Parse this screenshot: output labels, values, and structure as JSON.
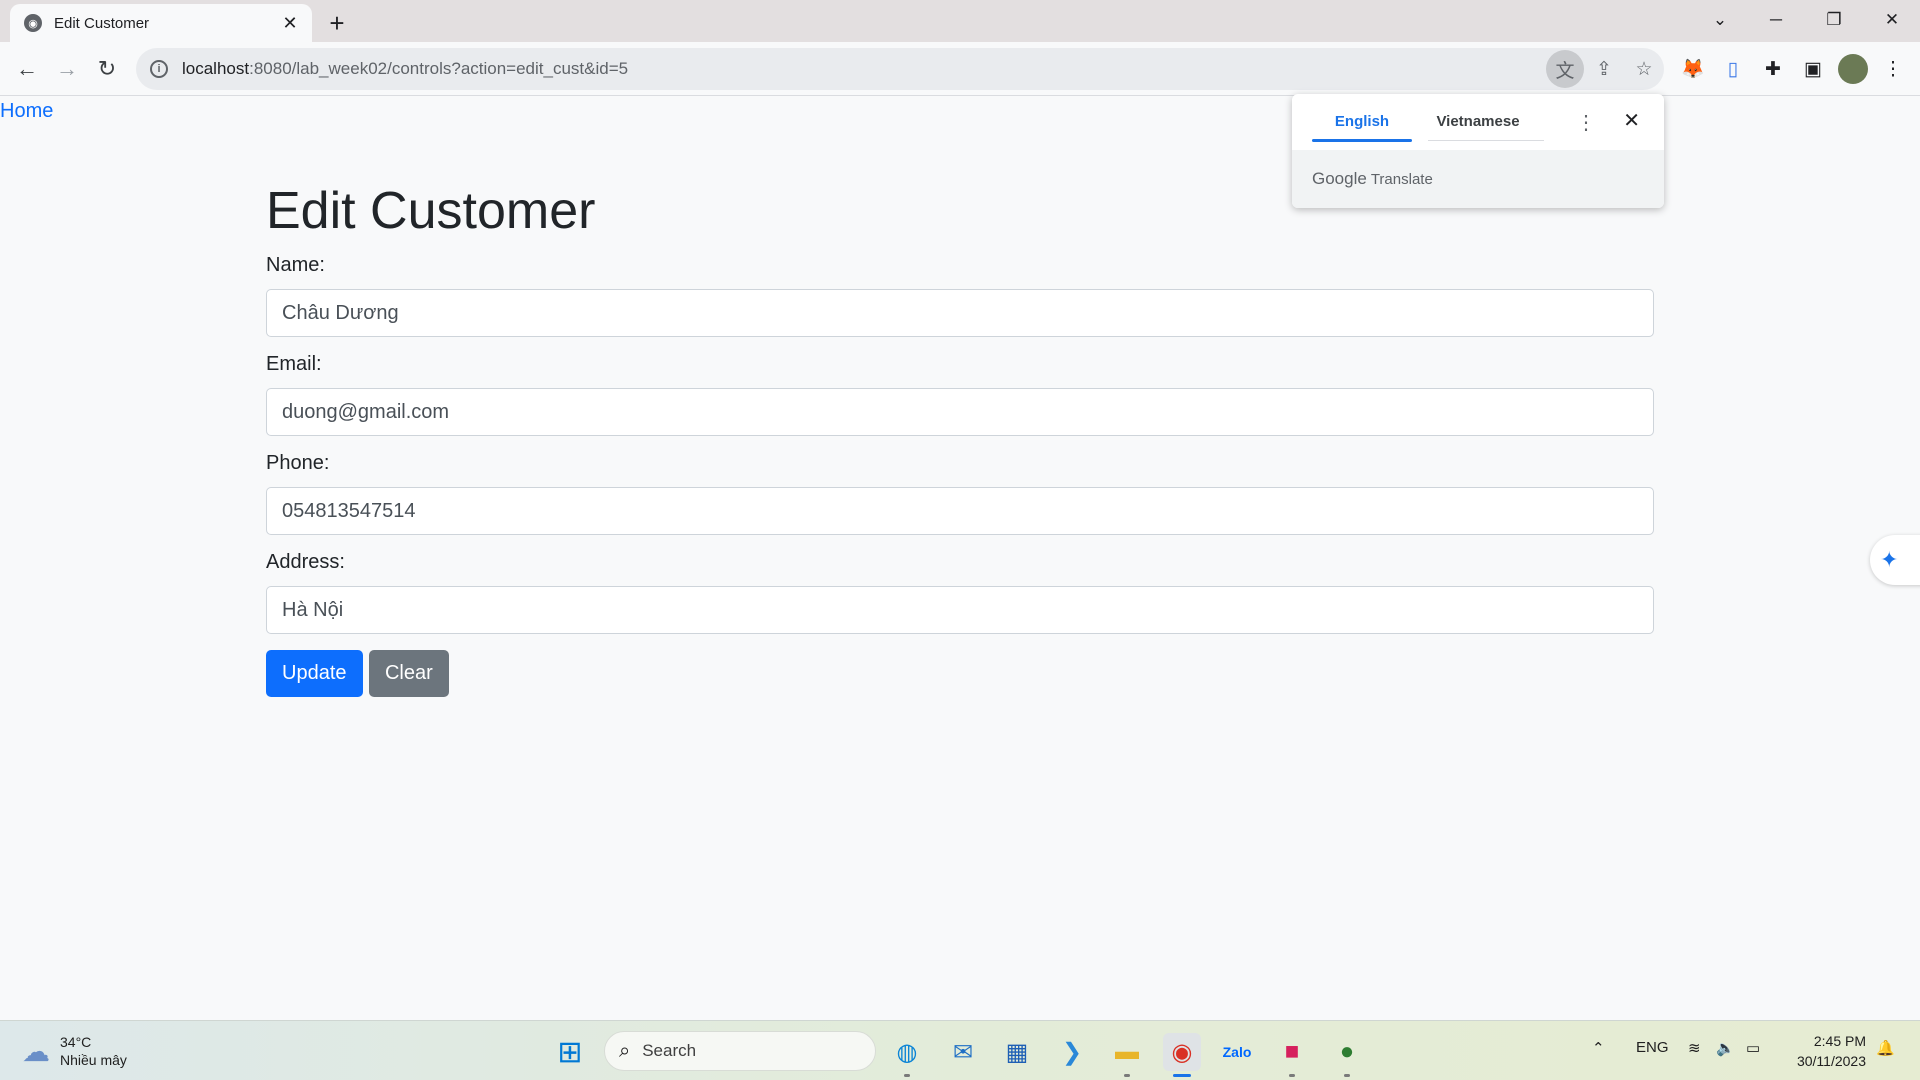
{
  "browser": {
    "tab_title": "Edit Customer",
    "url_host": "localhost",
    "url_rest": ":8080/lab_week02/controls?action=edit_cust&id=5"
  },
  "page": {
    "home_link": "Home",
    "heading": "Edit Customer",
    "fields": {
      "name": {
        "label": "Name:",
        "value": "Châu Dương"
      },
      "email": {
        "label": "Email:",
        "value": "duong@gmail.com"
      },
      "phone": {
        "label": "Phone:",
        "value": "054813547514"
      },
      "address": {
        "label": "Address:",
        "value": "Hà Nội"
      }
    },
    "buttons": {
      "update": "Update",
      "clear": "Clear"
    }
  },
  "translate_popup": {
    "tab_source": "English",
    "tab_target": "Vietnamese",
    "brand_google": "Google",
    "brand_translate": "Translate"
  },
  "taskbar": {
    "temperature": "34°C",
    "weather_desc": "Nhiều mây",
    "search_label": "Search",
    "language": "ENG",
    "time": "2:45 PM",
    "date": "30/11/2023"
  },
  "colors": {
    "primary": "#0d6efd",
    "secondary": "#6c757d",
    "link": "#0d6efd",
    "translate_accent": "#1a73e8"
  }
}
